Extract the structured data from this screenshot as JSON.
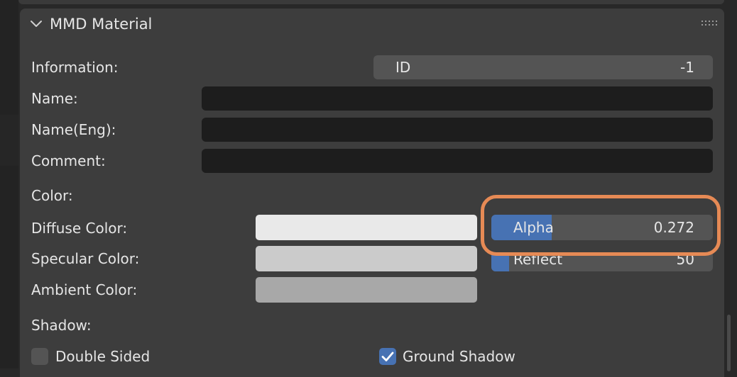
{
  "panel": {
    "title": "MMD Material",
    "icons": {
      "collapse": "chevron-down-icon",
      "drag": "grip-dots-icon"
    }
  },
  "information": {
    "label": "Information:",
    "id_label": "ID",
    "id_value": "-1"
  },
  "name": {
    "label": "Name:",
    "value": ""
  },
  "name_eng": {
    "label": "Name(Eng):",
    "value": ""
  },
  "comment": {
    "label": "Comment:",
    "value": ""
  },
  "color": {
    "section_label": "Color:",
    "diffuse": {
      "label": "Diffuse Color:",
      "swatch": "#e9e9e9"
    },
    "specular": {
      "label": "Specular Color:",
      "swatch": "#cbcbcb"
    },
    "ambient": {
      "label": "Ambient Color:",
      "swatch": "#a8a8a8"
    },
    "alpha": {
      "label": "Alpha",
      "value": "0.272",
      "fraction": 0.272
    },
    "reflect": {
      "label": "Reflect",
      "value": "50",
      "fraction": 0.08
    }
  },
  "shadow": {
    "section_label": "Shadow:",
    "double_sided": {
      "label": "Double Sided",
      "checked": false
    },
    "ground_shadow": {
      "label": "Ground Shadow",
      "checked": true
    }
  },
  "colors": {
    "accent": "#4772b3",
    "highlight": "#e68a55",
    "panel": "#3d3d3d",
    "input": "#1d1d1d"
  }
}
